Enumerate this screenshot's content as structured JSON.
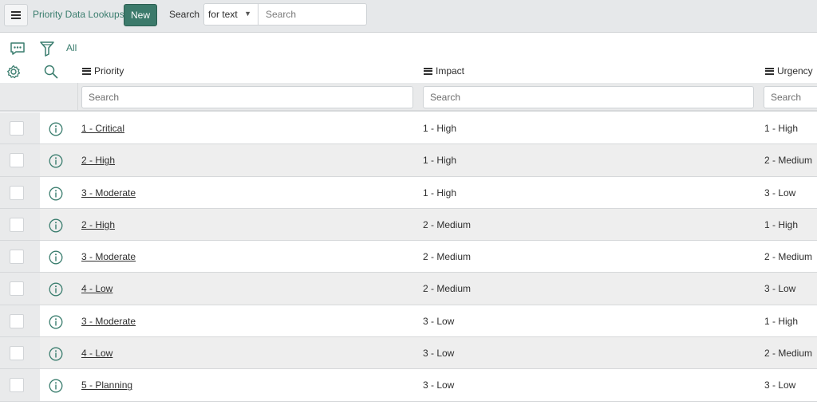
{
  "header": {
    "title": "Priority Data Lookups",
    "new_label": "New",
    "search_label": "Search",
    "search_field_selected": "for text",
    "search_placeholder": "Search"
  },
  "toolbar": {
    "filter_all_label": "All",
    "icons": [
      "chat-icon",
      "filter-icon",
      "gear-icon",
      "search-icon"
    ]
  },
  "colors": {
    "accent": "#3c7a6b",
    "topbar_bg": "#e6e8ea",
    "row_alt_bg": "#eeeeee"
  },
  "table": {
    "columns": [
      {
        "label": "Priority",
        "filter_placeholder": "Search"
      },
      {
        "label": "Impact",
        "filter_placeholder": "Search"
      },
      {
        "label": "Urgency",
        "filter_placeholder": "Search"
      }
    ],
    "rows": [
      {
        "priority": "1 - Critical",
        "impact": "1 - High",
        "urgency": "1 - High"
      },
      {
        "priority": "2 - High",
        "impact": "1 - High",
        "urgency": "2 - Medium"
      },
      {
        "priority": "3 - Moderate",
        "impact": "1 - High",
        "urgency": "3 - Low"
      },
      {
        "priority": "2 - High",
        "impact": "2 - Medium",
        "urgency": "1 - High"
      },
      {
        "priority": "3 - Moderate",
        "impact": "2 - Medium",
        "urgency": "2 - Medium"
      },
      {
        "priority": "4 - Low",
        "impact": "2 - Medium",
        "urgency": "3 - Low"
      },
      {
        "priority": "3 - Moderate",
        "impact": "3 - Low",
        "urgency": "1 - High"
      },
      {
        "priority": "4 - Low",
        "impact": "3 - Low",
        "urgency": "2 - Medium"
      },
      {
        "priority": "5 - Planning",
        "impact": "3 - Low",
        "urgency": "3 - Low"
      }
    ]
  }
}
